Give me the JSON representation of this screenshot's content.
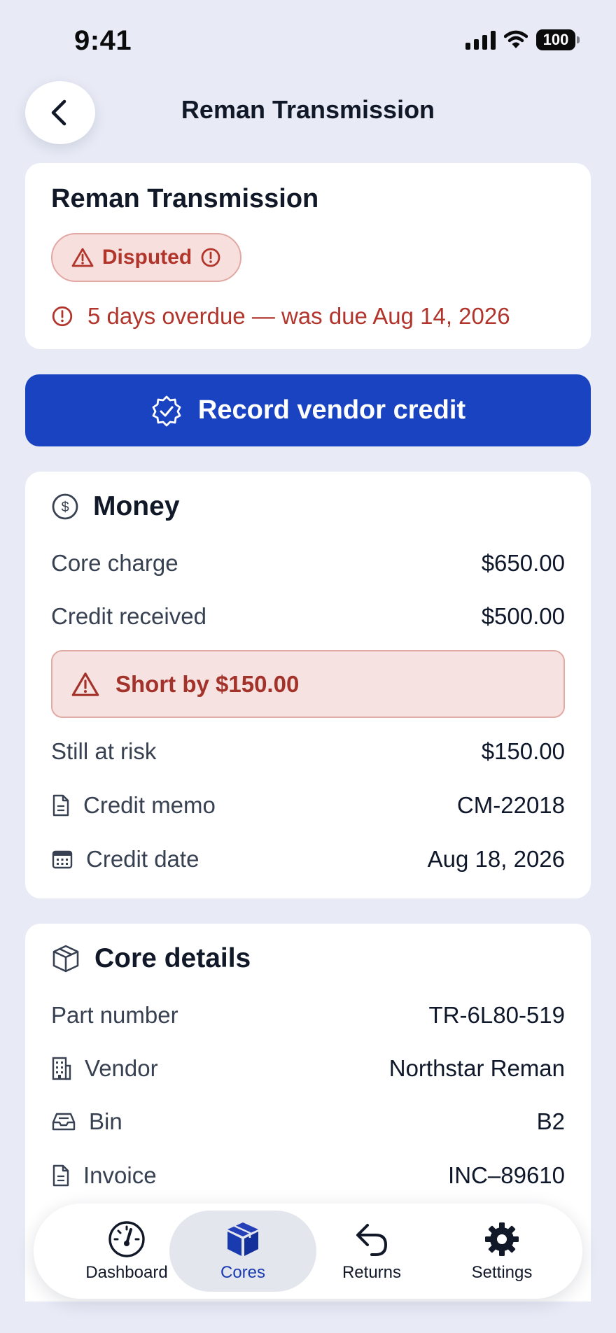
{
  "status_bar": {
    "time": "9:41",
    "battery": "100"
  },
  "header": {
    "title": "Reman Transmission",
    "back_icon": "chevron-left-icon"
  },
  "summary": {
    "title": "Reman Transmission",
    "status_badge": "Disputed",
    "overdue_text": "5 days overdue — was due Aug 14, 2026"
  },
  "actions": {
    "record_credit_label": "Record vendor credit"
  },
  "money": {
    "title": "Money",
    "core_charge_label": "Core charge",
    "core_charge_value": "$650.00",
    "credit_received_label": "Credit received",
    "credit_received_value": "$500.00",
    "short_alert": "Short by $150.00",
    "still_at_risk_label": "Still at risk",
    "still_at_risk_value": "$150.00",
    "credit_memo_label": "Credit memo",
    "credit_memo_value": "CM-22018",
    "credit_date_label": "Credit date",
    "credit_date_value": "Aug 18, 2026"
  },
  "core_details": {
    "title": "Core details",
    "part_number_label": "Part number",
    "part_number_value": "TR-6L80-519",
    "vendor_label": "Vendor",
    "vendor_value": "Northstar Reman",
    "bin_label": "Bin",
    "bin_value": "B2",
    "invoice_label": "Invoice",
    "invoice_value": "INC–89610"
  },
  "tab_bar": {
    "tabs": [
      {
        "label": "Dashboard",
        "icon": "gauge-icon"
      },
      {
        "label": "Cores",
        "icon": "box-icon"
      },
      {
        "label": "Returns",
        "icon": "return-arrow-icon"
      },
      {
        "label": "Settings",
        "icon": "gear-icon"
      }
    ],
    "active": "Cores"
  },
  "colors": {
    "primary": "#1a43c2",
    "danger": "#b2352c",
    "background": "#e8ebf6",
    "active_tab": "#1a3bb0"
  }
}
